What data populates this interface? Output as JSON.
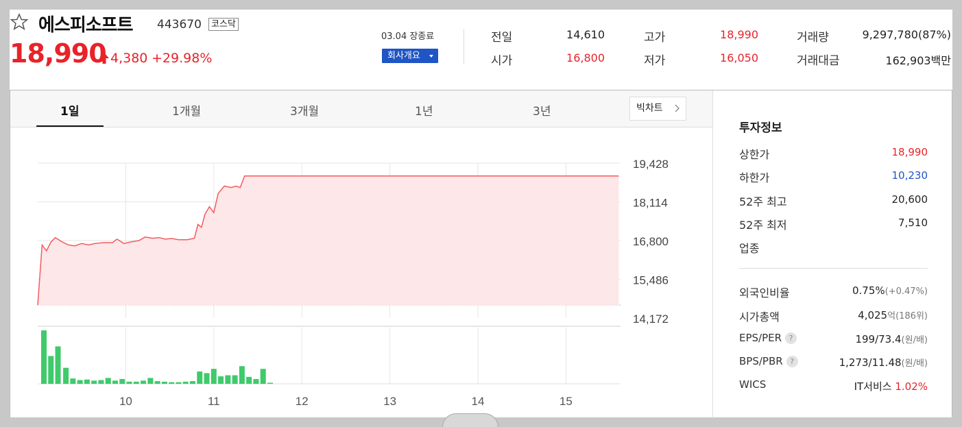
{
  "header": {
    "name": "에스피소프트",
    "code": "443670",
    "market": "코스닥",
    "price": "18,990",
    "change": "4,380",
    "change_pct": "+29.98%",
    "date_status": "03.04 장종료",
    "company_button": "회사개요",
    "up_color": "#e8232a",
    "down_color": "#1f55c4"
  },
  "quotes": {
    "prev_label": "전일",
    "prev": "14,610",
    "open_label": "시가",
    "open": "16,800",
    "high_label": "고가",
    "high": "18,990",
    "low_label": "저가",
    "low": "16,050",
    "volume_label": "거래량",
    "volume": "9,297,780(87%)",
    "amount_label": "거래대금",
    "amount": "162,903백만"
  },
  "tabs": [
    "1일",
    "1개월",
    "3개월",
    "1년",
    "3년"
  ],
  "big_chart_label": "빅차트",
  "chart_data": {
    "type": "line",
    "title": "",
    "x_tick_labels": [
      "10",
      "11",
      "12",
      "13",
      "14",
      "15"
    ],
    "y_tick_labels": [
      "19,428",
      "18,114",
      "16,800",
      "15,486",
      "14,172"
    ],
    "ylim": [
      14172,
      19428
    ],
    "baseline": 14610,
    "grid": true,
    "line_color": "#f15b5f",
    "fill_color": "#fde7e8",
    "volume_color": "#3fca6b",
    "price_series": [
      {
        "t": 9.0,
        "v": 14610
      },
      {
        "t": 9.05,
        "v": 16650
      },
      {
        "t": 9.1,
        "v": 16450
      },
      {
        "t": 9.15,
        "v": 16750
      },
      {
        "t": 9.2,
        "v": 16900
      },
      {
        "t": 9.28,
        "v": 16750
      },
      {
        "t": 9.35,
        "v": 16650
      },
      {
        "t": 9.42,
        "v": 16620
      },
      {
        "t": 9.5,
        "v": 16700
      },
      {
        "t": 9.58,
        "v": 16650
      },
      {
        "t": 9.65,
        "v": 16700
      },
      {
        "t": 9.75,
        "v": 16730
      },
      {
        "t": 9.85,
        "v": 16730
      },
      {
        "t": 9.9,
        "v": 16850
      },
      {
        "t": 9.98,
        "v": 16700
      },
      {
        "t": 10.05,
        "v": 16750
      },
      {
        "t": 10.15,
        "v": 16800
      },
      {
        "t": 10.22,
        "v": 16920
      },
      {
        "t": 10.3,
        "v": 16880
      },
      {
        "t": 10.38,
        "v": 16900
      },
      {
        "t": 10.45,
        "v": 16850
      },
      {
        "t": 10.52,
        "v": 16870
      },
      {
        "t": 10.6,
        "v": 16830
      },
      {
        "t": 10.7,
        "v": 16830
      },
      {
        "t": 10.78,
        "v": 16880
      },
      {
        "t": 10.82,
        "v": 17350
      },
      {
        "t": 10.86,
        "v": 17250
      },
      {
        "t": 10.9,
        "v": 17700
      },
      {
        "t": 10.95,
        "v": 17950
      },
      {
        "t": 11.0,
        "v": 17750
      },
      {
        "t": 11.05,
        "v": 18400
      },
      {
        "t": 11.12,
        "v": 18650
      },
      {
        "t": 11.2,
        "v": 18600
      },
      {
        "t": 11.25,
        "v": 18650
      },
      {
        "t": 11.3,
        "v": 18600
      },
      {
        "t": 11.35,
        "v": 18990
      },
      {
        "t": 15.6,
        "v": 18990
      }
    ],
    "volume_series": [
      {
        "t": 9.07,
        "v": 100
      },
      {
        "t": 9.15,
        "v": 52
      },
      {
        "t": 9.23,
        "v": 70
      },
      {
        "t": 9.32,
        "v": 30
      },
      {
        "t": 9.4,
        "v": 10
      },
      {
        "t": 9.48,
        "v": 7
      },
      {
        "t": 9.56,
        "v": 8
      },
      {
        "t": 9.64,
        "v": 6
      },
      {
        "t": 9.72,
        "v": 7
      },
      {
        "t": 9.8,
        "v": 11
      },
      {
        "t": 9.88,
        "v": 6
      },
      {
        "t": 9.96,
        "v": 9
      },
      {
        "t": 10.04,
        "v": 4
      },
      {
        "t": 10.12,
        "v": 4
      },
      {
        "t": 10.2,
        "v": 6
      },
      {
        "t": 10.28,
        "v": 11
      },
      {
        "t": 10.36,
        "v": 5
      },
      {
        "t": 10.44,
        "v": 4
      },
      {
        "t": 10.52,
        "v": 3
      },
      {
        "t": 10.6,
        "v": 3
      },
      {
        "t": 10.68,
        "v": 4
      },
      {
        "t": 10.76,
        "v": 5
      },
      {
        "t": 10.84,
        "v": 23
      },
      {
        "t": 10.92,
        "v": 20
      },
      {
        "t": 11.0,
        "v": 28
      },
      {
        "t": 11.08,
        "v": 14
      },
      {
        "t": 11.16,
        "v": 16
      },
      {
        "t": 11.24,
        "v": 16
      },
      {
        "t": 11.32,
        "v": 33
      },
      {
        "t": 11.4,
        "v": 13
      },
      {
        "t": 11.48,
        "v": 9
      },
      {
        "t": 11.56,
        "v": 28
      },
      {
        "t": 11.64,
        "v": 2
      }
    ]
  },
  "invest": {
    "title": "투자정보",
    "upper_limit_label": "상한가",
    "upper_limit": "18,990",
    "lower_limit_label": "하한가",
    "lower_limit": "10,230",
    "w52_high_label": "52주 최고",
    "w52_high": "20,600",
    "w52_low_label": "52주 최저",
    "w52_low": "7,510",
    "sector_label": "업종",
    "foreign_label": "외국인비율",
    "foreign": "0.75%",
    "foreign_change": "(+0.47%)",
    "mcap_label": "시가총액",
    "mcap": "4,025",
    "mcap_unit": "억(186위)",
    "eps_per_label": "EPS/PER",
    "eps_per": "199/73.4",
    "eps_per_unit": "(원/배)",
    "bps_pbr_label": "BPS/PBR",
    "bps_pbr": "1,273/11.48",
    "bps_pbr_unit": "(원/배)",
    "help_mark": "?",
    "wics_label": "WICS",
    "wics_name": "IT서비스",
    "wics_pct": "1.02%"
  }
}
